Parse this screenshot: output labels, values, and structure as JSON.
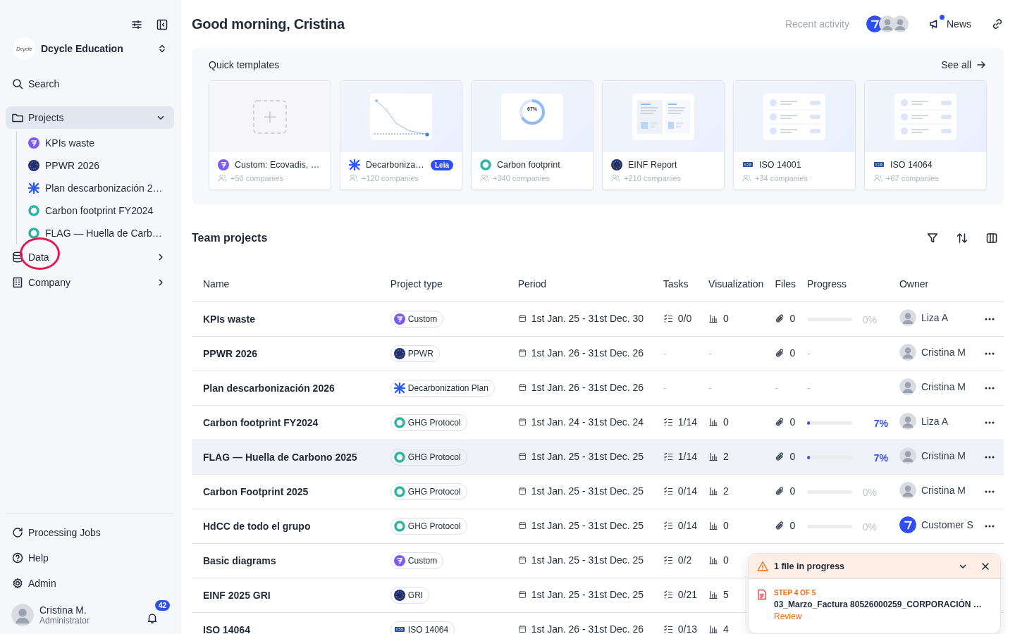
{
  "sidebar": {
    "org": {
      "logo": "Dcycle",
      "name": "Dcycle Education"
    },
    "search": "Search",
    "nav": [
      {
        "label": "Projects",
        "expanded": true,
        "selected": true,
        "children": [
          {
            "label": "KPIs waste",
            "kind": "custom"
          },
          {
            "label": "PPWR 2026",
            "kind": "eu"
          },
          {
            "label": "Plan descarbonización 2…",
            "kind": "decarb"
          },
          {
            "label": "Carbon footprint FY2024",
            "kind": "ghg"
          },
          {
            "label": "FLAG — Huella de Carb…",
            "kind": "ghg"
          }
        ]
      },
      {
        "label": "Data",
        "expanded": false,
        "selected": false,
        "circled": true
      },
      {
        "label": "Company",
        "expanded": false,
        "selected": false
      }
    ],
    "bottom": [
      {
        "label": "Processing Jobs"
      },
      {
        "label": "Help"
      },
      {
        "label": "Admin"
      }
    ],
    "user": {
      "name": "Cristina M.",
      "role": "Administrator",
      "notifications": "42"
    }
  },
  "header": {
    "greeting": "Good morning, Cristina",
    "recent": "Recent activity",
    "news": "News",
    "news_unread": true
  },
  "templates": {
    "title": "Quick templates",
    "see_all": "See all",
    "items": [
      {
        "kind": "custom",
        "name": "Custom: Ecovadis, …",
        "companies": "+50 companies"
      },
      {
        "kind": "decarb",
        "name": "Decarboniza…",
        "badge": "Leia",
        "companies": "+120 companies"
      },
      {
        "kind": "ghg",
        "name": "Carbon footprint",
        "companies": "+340 companies",
        "preview_text": "67%"
      },
      {
        "kind": "eu",
        "name": "EINF Report",
        "companies": "+210 companies"
      },
      {
        "kind": "iso",
        "name": "ISO 14001",
        "companies": "+34 companies"
      },
      {
        "kind": "iso",
        "name": "ISO 14064",
        "companies": "+67 companies"
      }
    ]
  },
  "projects": {
    "title": "Team projects",
    "columns": [
      "Name",
      "Project type",
      "Period",
      "Tasks",
      "Visualization",
      "Files",
      "Progress",
      "Owner"
    ],
    "rows": [
      {
        "name": "KPIs waste",
        "type": {
          "label": "Custom",
          "kind": "custom"
        },
        "period": "1st Jan. 25 - 31st Dec. 30",
        "tasks": {
          "kind": "count",
          "text": "0/0"
        },
        "visualization": {
          "kind": "count",
          "text": "0"
        },
        "files": {
          "kind": "count",
          "text": "0"
        },
        "progress": {
          "kind": "bar",
          "level": 0,
          "reading": "0%"
        },
        "owner": {
          "name": "Liza A",
          "kind": "person"
        },
        "selected": false
      },
      {
        "name": "PPWR 2026",
        "type": {
          "label": "PPWR",
          "kind": "eu"
        },
        "period": "1st Jan. 26 - 31st Dec. 26",
        "tasks": {
          "kind": "empty",
          "text": "-"
        },
        "visualization": {
          "kind": "empty",
          "text": "-"
        },
        "files": {
          "kind": "count",
          "text": "0"
        },
        "progress": {
          "kind": "empty",
          "reading": "-"
        },
        "owner": {
          "name": "Cristina M",
          "kind": "person"
        },
        "selected": false
      },
      {
        "name": "Plan descarbonización 2026",
        "type": {
          "label": "Decarbonization Plan",
          "kind": "decarb"
        },
        "period": "1st Jan. 26 - 31st Dec. 26",
        "tasks": {
          "kind": "empty",
          "text": "-"
        },
        "visualization": {
          "kind": "empty",
          "text": "-"
        },
        "files": {
          "kind": "empty",
          "text": "-"
        },
        "progress": {
          "kind": "empty",
          "reading": "-"
        },
        "owner": {
          "name": "Cristina M",
          "kind": "person"
        },
        "selected": false
      },
      {
        "name": "Carbon footprint FY2024",
        "type": {
          "label": "GHG Protocol",
          "kind": "ghg"
        },
        "period": "1st Jan. 24 - 31st Dec. 24",
        "tasks": {
          "kind": "count",
          "text": "1/14"
        },
        "visualization": {
          "kind": "count",
          "text": "0"
        },
        "files": {
          "kind": "count",
          "text": "0"
        },
        "progress": {
          "kind": "bar",
          "level": 0.07,
          "reading": "7%"
        },
        "owner": {
          "name": "Liza A",
          "kind": "person"
        },
        "selected": false
      },
      {
        "name": "FLAG — Huella de Carbono 2025",
        "type": {
          "label": "GHG Protocol",
          "kind": "ghg"
        },
        "period": "1st Jan. 25 - 31st Dec. 25",
        "tasks": {
          "kind": "count",
          "text": "1/14"
        },
        "visualization": {
          "kind": "count",
          "text": "2"
        },
        "files": {
          "kind": "count",
          "text": "0"
        },
        "progress": {
          "kind": "bar",
          "level": 0.07,
          "reading": "7%"
        },
        "owner": {
          "name": "Cristina M",
          "kind": "person"
        },
        "selected": true
      },
      {
        "name": "Carbon Footprint 2025",
        "type": {
          "label": "GHG Protocol",
          "kind": "ghg"
        },
        "period": "1st Jan. 25 - 31st Dec. 25",
        "tasks": {
          "kind": "count",
          "text": "0/14"
        },
        "visualization": {
          "kind": "count",
          "text": "2"
        },
        "files": {
          "kind": "count",
          "text": "0"
        },
        "progress": {
          "kind": "bar",
          "level": 0,
          "reading": "0%"
        },
        "owner": {
          "name": "Cristina M",
          "kind": "person"
        },
        "selected": false
      },
      {
        "name": "HdCC de todo el grupo",
        "type": {
          "label": "GHG Protocol",
          "kind": "ghg"
        },
        "period": "1st Jan. 25 - 31st Dec. 25",
        "tasks": {
          "kind": "count",
          "text": "0/14"
        },
        "visualization": {
          "kind": "count",
          "text": "0"
        },
        "files": {
          "kind": "count",
          "text": "0"
        },
        "progress": {
          "kind": "bar",
          "level": 0,
          "reading": "0%"
        },
        "owner": {
          "name": "Customer S",
          "kind": "brand"
        },
        "selected": false
      },
      {
        "name": "Basic diagrams",
        "type": {
          "label": "Custom",
          "kind": "custom"
        },
        "period": "1st Jan. 25 - 31st Dec. 25",
        "tasks": {
          "kind": "count",
          "text": "0/2"
        },
        "visualization": {
          "kind": "count",
          "text": "0"
        },
        "selected": false
      },
      {
        "name": "EINF 2025 GRI",
        "type": {
          "label": "GRI",
          "kind": "eu"
        },
        "period": "1st Jan. 25 - 31st Dec. 25",
        "tasks": {
          "kind": "count",
          "text": "0/21"
        },
        "visualization": {
          "kind": "count",
          "text": "5"
        },
        "selected": false
      },
      {
        "name": "ISO 14064",
        "type": {
          "label": "ISO 14064",
          "kind": "iso"
        },
        "period": "1st Jan. 26 - 31st Dec. 26",
        "tasks": {
          "kind": "count",
          "text": "0/13"
        },
        "visualization": {
          "kind": "count",
          "text": "4"
        },
        "selected": false
      }
    ]
  },
  "toast": {
    "title": "1 file in progress",
    "step": "STEP 4 OF 5",
    "file": "03_Marzo_Factura 80526000259_CORPORACIÓN …",
    "action": "Review"
  }
}
